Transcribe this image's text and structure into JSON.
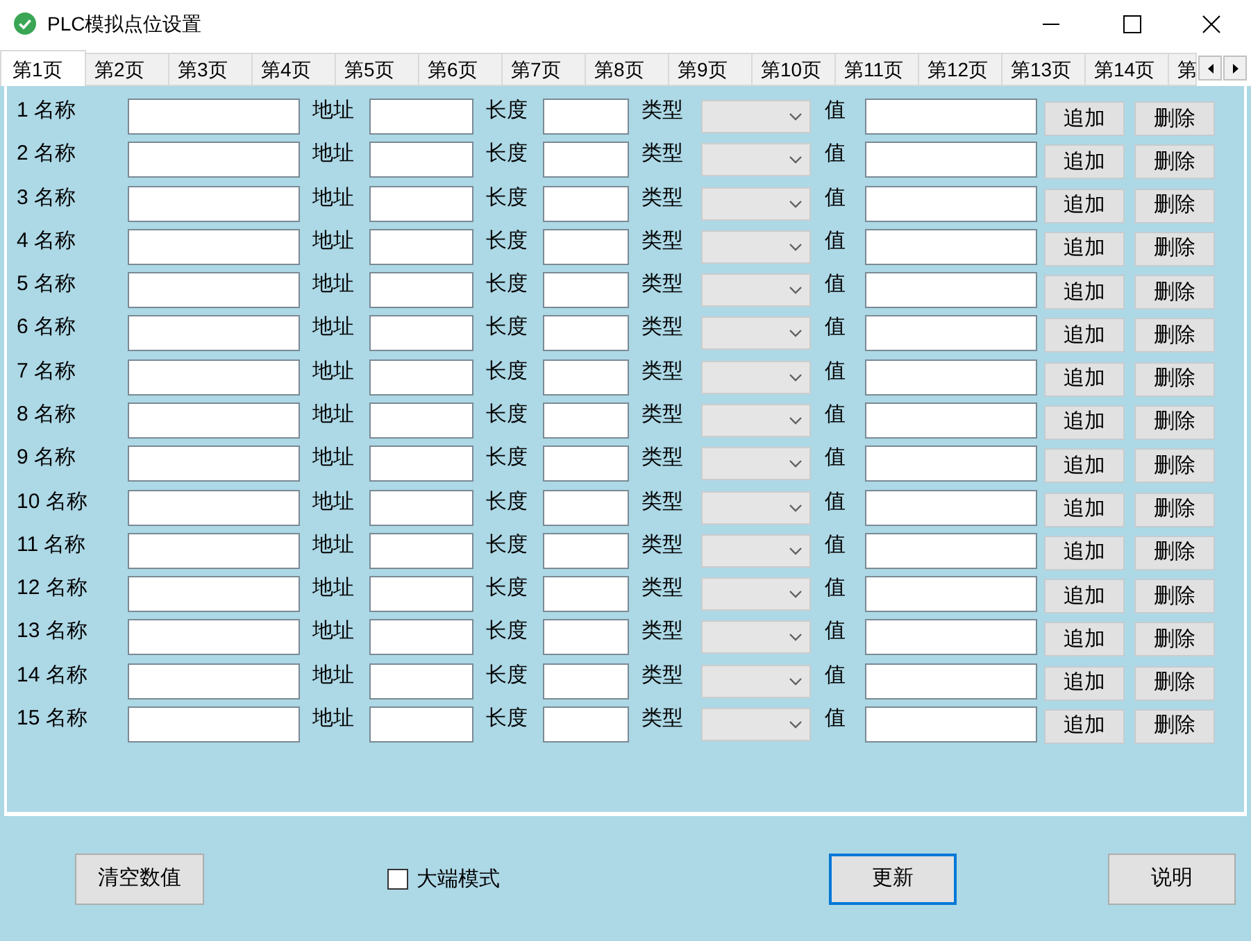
{
  "window": {
    "title": "PLC模拟点位设置"
  },
  "tabs": [
    {
      "label": "第1页",
      "selected": true
    },
    {
      "label": "第2页",
      "selected": false
    },
    {
      "label": "第3页",
      "selected": false
    },
    {
      "label": "第4页",
      "selected": false
    },
    {
      "label": "第5页",
      "selected": false
    },
    {
      "label": "第6页",
      "selected": false
    },
    {
      "label": "第7页",
      "selected": false
    },
    {
      "label": "第8页",
      "selected": false
    },
    {
      "label": "第9页",
      "selected": false
    },
    {
      "label": "第10页",
      "selected": false
    },
    {
      "label": "第11页",
      "selected": false
    },
    {
      "label": "第12页",
      "selected": false
    },
    {
      "label": "第13页",
      "selected": false
    },
    {
      "label": "第14页",
      "selected": false
    },
    {
      "label": "第",
      "selected": false
    }
  ],
  "rows": [
    {
      "label": "1 名称",
      "address_label": "地址",
      "length_label": "长度",
      "type_label": "类型",
      "value_label": "值",
      "add_button": "追加",
      "delete_button": "删除"
    },
    {
      "label": "2 名称",
      "address_label": "地址",
      "length_label": "长度",
      "type_label": "类型",
      "value_label": "值",
      "add_button": "追加",
      "delete_button": "删除"
    },
    {
      "label": "3 名称",
      "address_label": "地址",
      "length_label": "长度",
      "type_label": "类型",
      "value_label": "值",
      "add_button": "追加",
      "delete_button": "删除"
    },
    {
      "label": "4 名称",
      "address_label": "地址",
      "length_label": "长度",
      "type_label": "类型",
      "value_label": "值",
      "add_button": "追加",
      "delete_button": "删除"
    },
    {
      "label": "5 名称",
      "address_label": "地址",
      "length_label": "长度",
      "type_label": "类型",
      "value_label": "值",
      "add_button": "追加",
      "delete_button": "删除"
    },
    {
      "label": "6 名称",
      "address_label": "地址",
      "length_label": "长度",
      "type_label": "类型",
      "value_label": "值",
      "add_button": "追加",
      "delete_button": "删除"
    },
    {
      "label": "7 名称",
      "address_label": "地址",
      "length_label": "长度",
      "type_label": "类型",
      "value_label": "值",
      "add_button": "追加",
      "delete_button": "删除"
    },
    {
      "label": "8 名称",
      "address_label": "地址",
      "length_label": "长度",
      "type_label": "类型",
      "value_label": "值",
      "add_button": "追加",
      "delete_button": "删除"
    },
    {
      "label": "9 名称",
      "address_label": "地址",
      "length_label": "长度",
      "type_label": "类型",
      "value_label": "值",
      "add_button": "追加",
      "delete_button": "删除"
    },
    {
      "label": "10 名称",
      "address_label": "地址",
      "length_label": "长度",
      "type_label": "类型",
      "value_label": "值",
      "add_button": "追加",
      "delete_button": "删除"
    },
    {
      "label": "11 名称",
      "address_label": "地址",
      "length_label": "长度",
      "type_label": "类型",
      "value_label": "值",
      "add_button": "追加",
      "delete_button": "删除"
    },
    {
      "label": "12 名称",
      "address_label": "地址",
      "length_label": "长度",
      "type_label": "类型",
      "value_label": "值",
      "add_button": "追加",
      "delete_button": "删除"
    },
    {
      "label": "13 名称",
      "address_label": "地址",
      "length_label": "长度",
      "type_label": "类型",
      "value_label": "值",
      "add_button": "追加",
      "delete_button": "删除"
    },
    {
      "label": "14 名称",
      "address_label": "地址",
      "length_label": "长度",
      "type_label": "类型",
      "value_label": "值",
      "add_button": "追加",
      "delete_button": "删除"
    },
    {
      "label": "15 名称",
      "address_label": "地址",
      "length_label": "长度",
      "type_label": "类型",
      "value_label": "值",
      "add_button": "追加",
      "delete_button": "删除"
    }
  ],
  "footer": {
    "buttons": [
      {
        "label": "清空数值",
        "focused": false
      },
      {
        "label": "更新",
        "focused": true
      },
      {
        "label": "说明",
        "focused": false
      }
    ],
    "checkbox": {
      "label": "大端模式",
      "checked": false
    }
  }
}
